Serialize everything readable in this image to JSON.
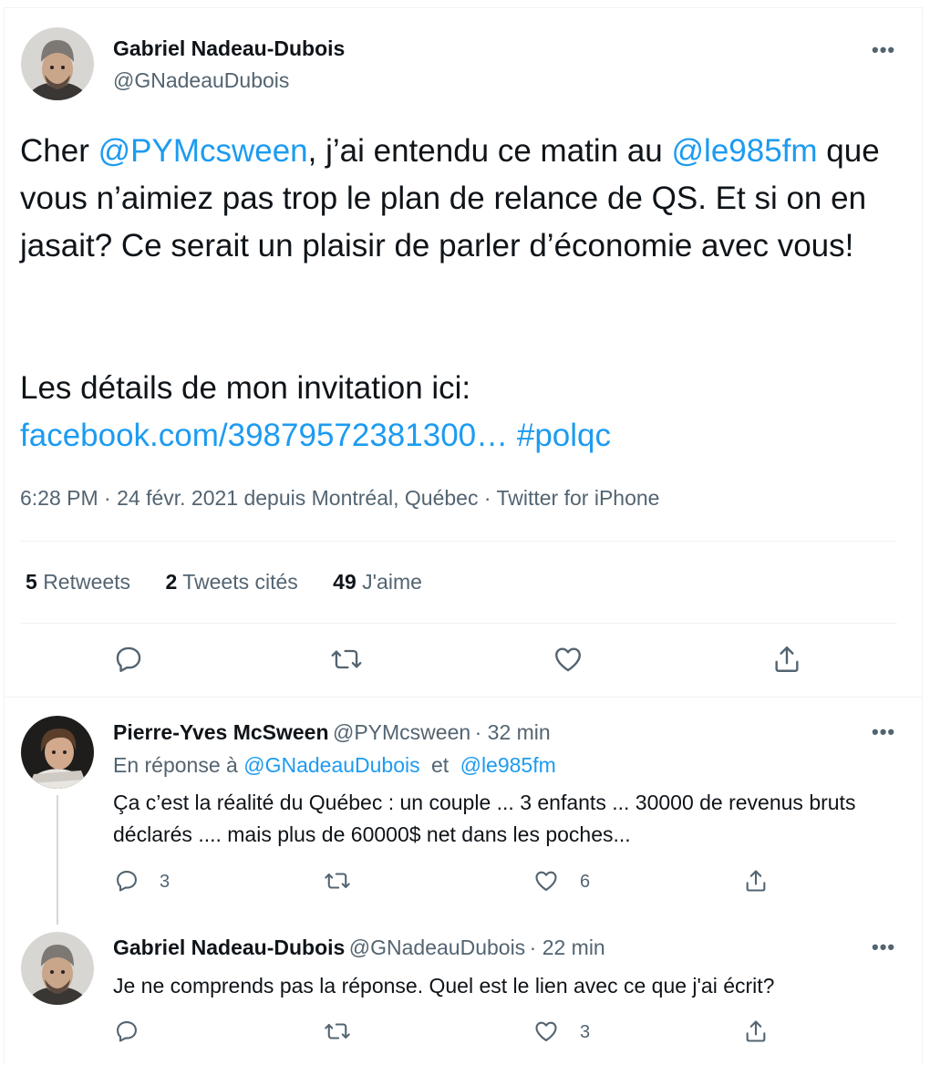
{
  "main_tweet": {
    "author_name": "Gabriel Nadeau-Dubois",
    "author_handle": "@GNadeauDubois",
    "more": "•••",
    "text_1": "Cher ",
    "mention_1": "@PYMcsween",
    "text_2": ", j’ai entendu ce matin au ",
    "mention_2": "@le985fm",
    "text_3": " que vous n’aimiez pas trop le plan de relance de QS. Et si on en jasait? Ce serait un plaisir de parler d’économie avec vous!",
    "text_4": "Les détails de mon invitation ici:",
    "link": "facebook.com/39879572381300…",
    "hashtag": "#polqc",
    "meta": "6:28 PM · 24 févr. 2021 depuis Montréal, Québec · Twitter for iPhone",
    "stats": {
      "retweets_count": "5",
      "retweets_label": "Retweets",
      "quotes_count": "2",
      "quotes_label": "Tweets cités",
      "likes_count": "49",
      "likes_label": "J'aime"
    }
  },
  "reply_1": {
    "author_name": "Pierre-Yves McSween",
    "author_handle": "@PYMcsween",
    "time": "· 32 min",
    "more": "•••",
    "reply_prefix": "En réponse à",
    "reply_to_1": "@GNadeauDubois",
    "reply_and": "et",
    "reply_to_2": "@le985fm",
    "text": "Ça c’est la réalité du Québec : un couple ... 3 enfants ... 30000 de revenus bruts déclarés .... mais plus de 60000$ net dans les poches...",
    "reply_count": "3",
    "retweet_count": "",
    "like_count": "6"
  },
  "reply_2": {
    "author_name": "Gabriel Nadeau-Dubois",
    "author_handle": "@GNadeauDubois",
    "time": "· 22 min",
    "more": "•••",
    "text": "Je ne comprends pas la réponse. Quel est le lien avec ce que j'ai écrit?",
    "reply_count": "",
    "retweet_count": "",
    "like_count": "3"
  },
  "colors": {
    "link": "#1d9bf0",
    "secondary": "#536471",
    "divider": "#eff3f4"
  }
}
